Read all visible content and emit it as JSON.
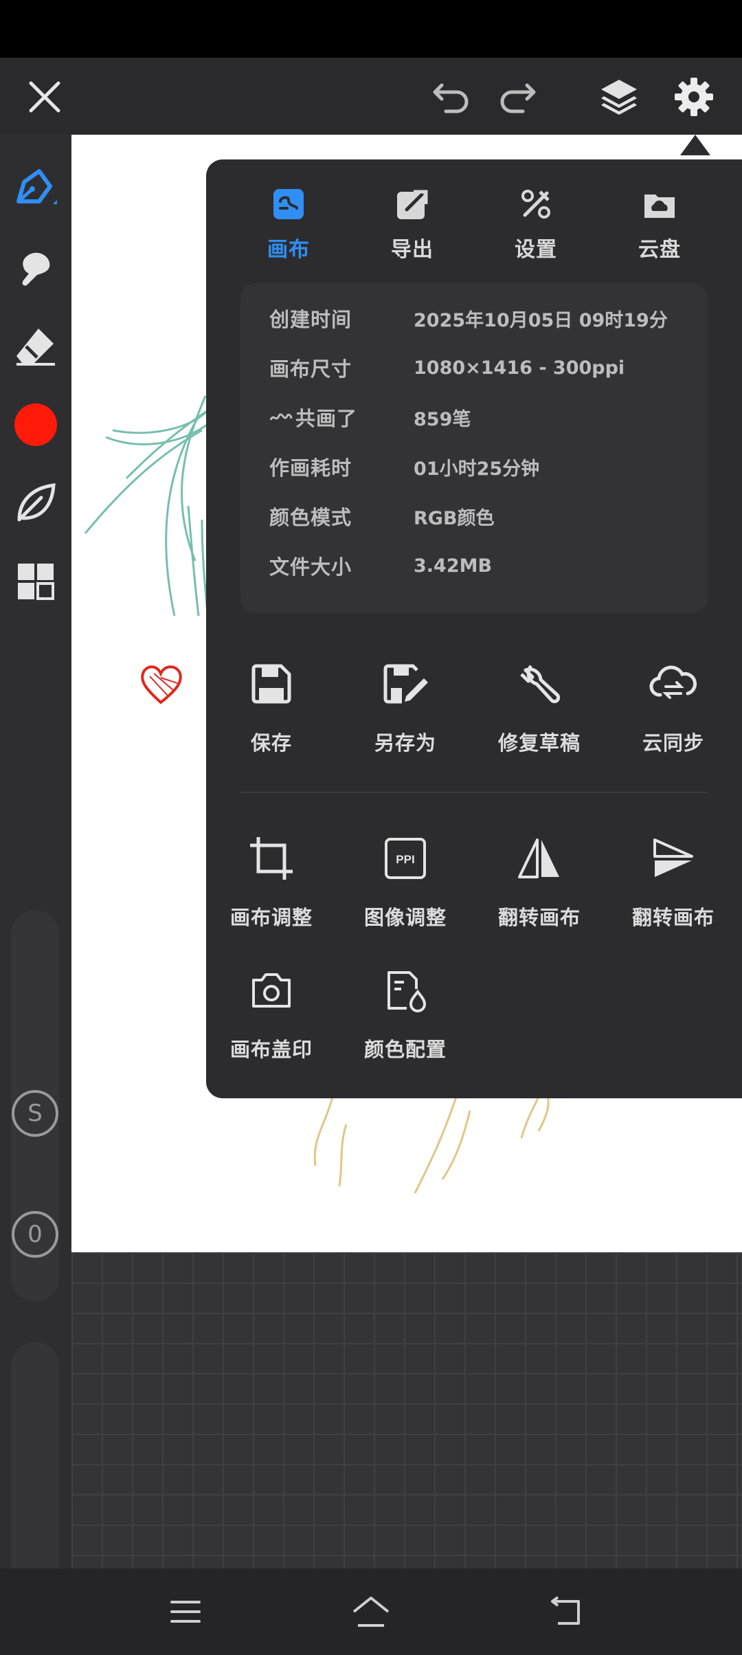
{
  "topbar": {
    "close_icon": "close-icon",
    "undo_icon": "undo-icon",
    "redo_icon": "redo-icon",
    "layers_icon": "layers-icon",
    "settings_icon": "gear-icon"
  },
  "tools": [
    {
      "name": "pen",
      "icon": "pen-icon",
      "active": true
    },
    {
      "name": "smudge",
      "icon": "smudge-icon"
    },
    {
      "name": "eraser",
      "icon": "eraser-icon"
    },
    {
      "name": "color",
      "icon": "color-swatch",
      "color": "#ff1a0a"
    },
    {
      "name": "leaf",
      "icon": "leaf-icon"
    },
    {
      "name": "grid",
      "icon": "grid-icon"
    }
  ],
  "sliders": {
    "size_label": "S",
    "opacity_label": "0"
  },
  "menu": {
    "tabs": [
      {
        "label": "画布",
        "icon": "canvas-icon",
        "active": true
      },
      {
        "label": "导出",
        "icon": "export-icon"
      },
      {
        "label": "设置",
        "icon": "tools-icon"
      },
      {
        "label": "云盘",
        "icon": "cloud-drive-icon"
      }
    ],
    "info": [
      {
        "key": "创建时间",
        "value": "2025年10月05日  09时19分"
      },
      {
        "key": "画布尺寸",
        "value": "1080×1416 - 300ppi"
      },
      {
        "key": "共画了",
        "value": "859笔"
      },
      {
        "key": "作画耗时",
        "value": "01小时25分钟"
      },
      {
        "key": "颜色模式",
        "value": "RGB颜色"
      },
      {
        "key": "文件大小",
        "value": "3.42MB"
      }
    ],
    "actions_row1": [
      {
        "label": "保存",
        "icon": "save-icon"
      },
      {
        "label": "另存为",
        "icon": "save-as-icon"
      },
      {
        "label": "修复草稿",
        "icon": "wrench-icon"
      },
      {
        "label": "云同步",
        "icon": "cloud-sync-icon"
      }
    ],
    "actions_row2": [
      {
        "label": "画布调整",
        "icon": "crop-icon"
      },
      {
        "label": "图像调整",
        "icon": "ppi-icon",
        "icon_text": "PPI"
      },
      {
        "label": "翻转画布",
        "icon": "flip-horizontal-icon"
      },
      {
        "label": "翻转画布",
        "icon": "flip-vertical-icon"
      }
    ],
    "actions_row3": [
      {
        "label": "画布盖印",
        "icon": "camera-icon"
      },
      {
        "label": "颜色配置",
        "icon": "color-profile-icon"
      }
    ]
  },
  "navbar": {
    "menu_icon": "menu-icon",
    "home_icon": "home-icon",
    "back_icon": "back-icon"
  },
  "colors": {
    "accent": "#2f8ff5",
    "panel": "#2c2c2e",
    "brush_color": "#ff1a0a"
  }
}
